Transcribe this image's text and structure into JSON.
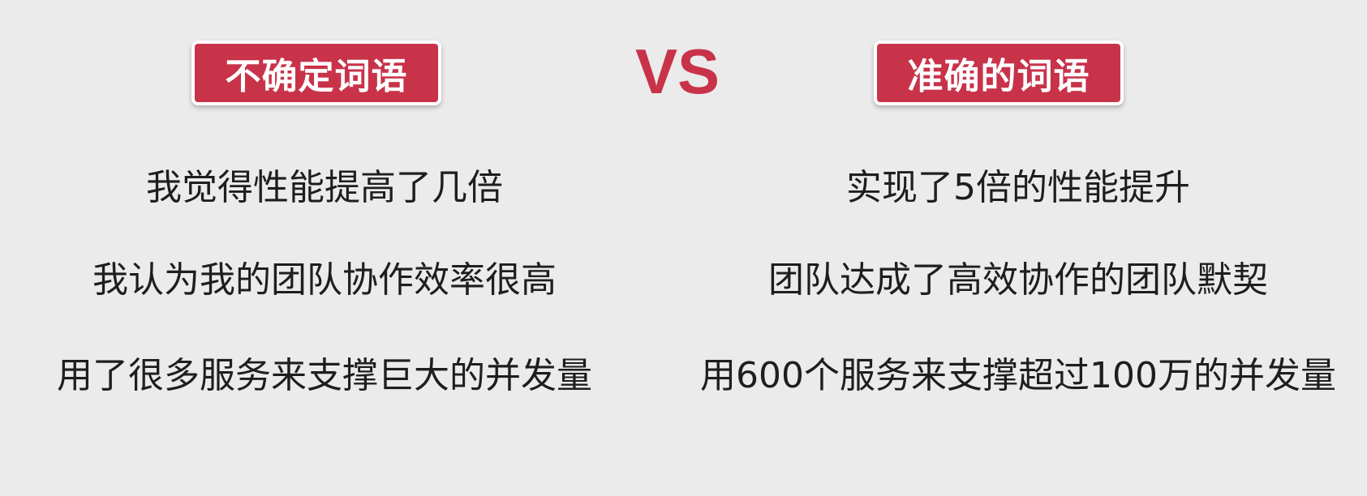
{
  "left": {
    "badge": "不确定词语",
    "lines": [
      "我觉得性能提高了几倍",
      "我认为我的团队协作效率很高",
      "用了很多服务来支撑巨大的并发量"
    ]
  },
  "vs_label": "VS",
  "right": {
    "badge": "准确的词语",
    "lines": [
      "实现了5倍的性能提升",
      "团队达成了高效协作的团队默契",
      "用600个服务来支撑超过100万的并发量"
    ]
  },
  "colors": {
    "accent": "#c8334a",
    "background": "#ebebeb",
    "text": "#1e1e1e"
  }
}
